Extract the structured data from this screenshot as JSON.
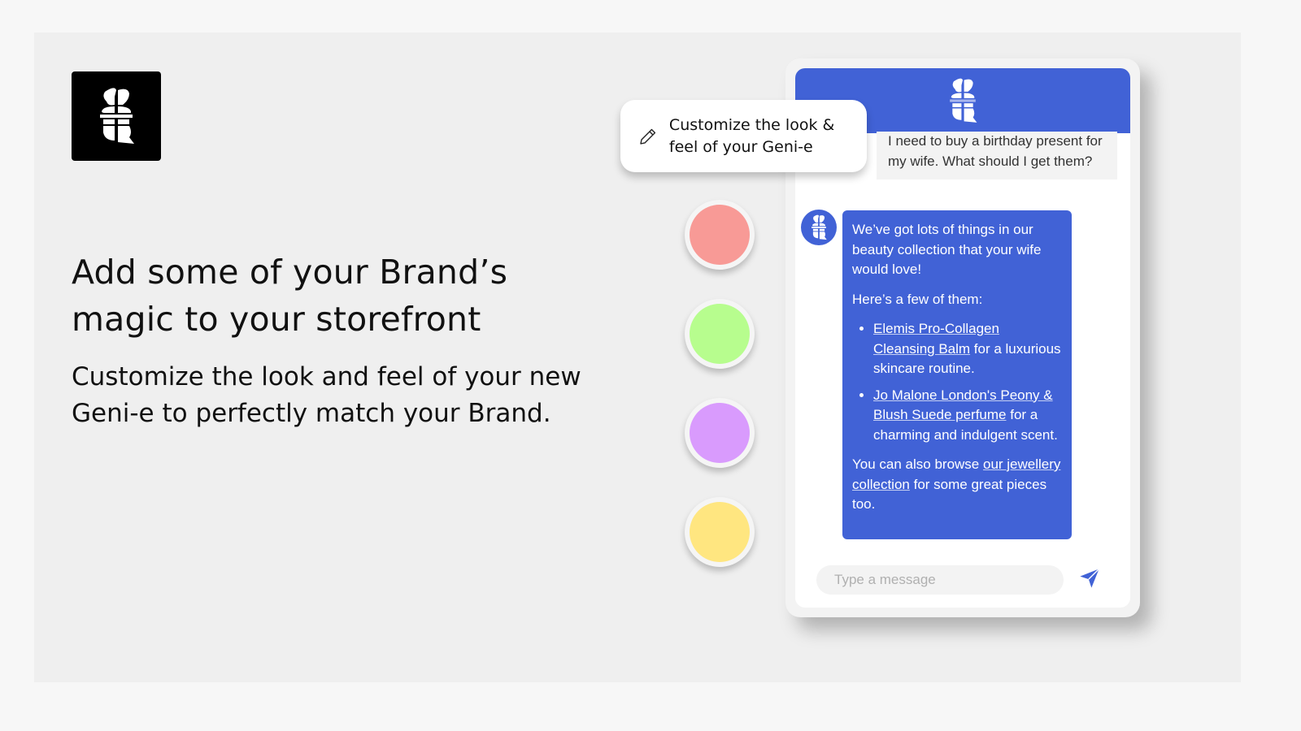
{
  "hero": {
    "headline": "Add some of your Brand’s magic to your storefront",
    "subtext": "Customize the look and feel of your new Geni-e to perfectly match your Brand."
  },
  "callout": {
    "icon": "pencil-icon",
    "text": "Customize the look & feel of your Geni-e"
  },
  "swatches": [
    {
      "name": "coral",
      "color": "#f89a96"
    },
    {
      "name": "green",
      "color": "#b7fd8e"
    },
    {
      "name": "purple",
      "color": "#d99bfd"
    },
    {
      "name": "yellow",
      "color": "#ffe680"
    }
  ],
  "chat": {
    "accent": "#4162d6",
    "user_message": "I need to buy a birthday present for my wife. What should I get them?",
    "bot": {
      "intro": "We’ve got lots of things in our beauty collection that your wife would love!",
      "lead": "Here’s a few of them:",
      "items": [
        {
          "link": "Elemis Pro-Collagen Cleansing Balm",
          "rest": " for a luxurious skincare routine."
        },
        {
          "link": "Jo Malone London's Peony & Blush Suede perfume",
          "rest": " for a charming and indulgent scent."
        }
      ],
      "outro_before": "You can also browse ",
      "outro_link": "our jewellery collection",
      "outro_after": " for some great pieces too."
    },
    "input_placeholder": "Type a message",
    "send_icon": "send-icon"
  }
}
